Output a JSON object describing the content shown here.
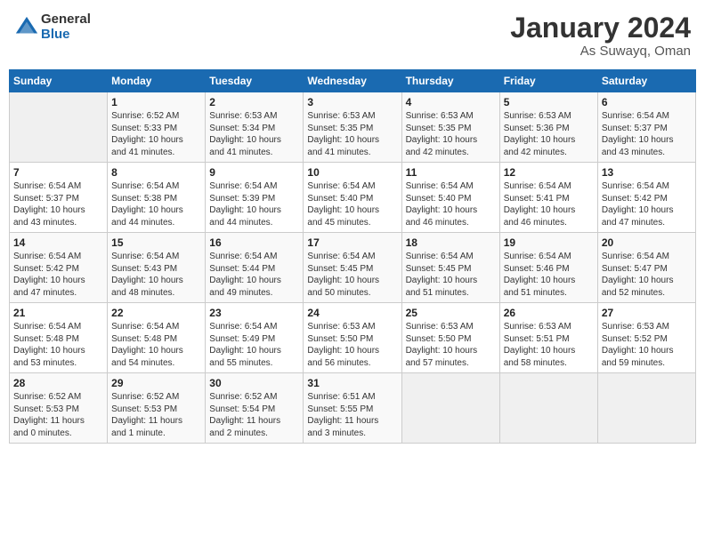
{
  "header": {
    "logo_general": "General",
    "logo_blue": "Blue",
    "month_title": "January 2024",
    "location": "As Suwayq, Oman"
  },
  "days_of_week": [
    "Sunday",
    "Monday",
    "Tuesday",
    "Wednesday",
    "Thursday",
    "Friday",
    "Saturday"
  ],
  "weeks": [
    [
      {
        "day": "",
        "info": ""
      },
      {
        "day": "1",
        "info": "Sunrise: 6:52 AM\nSunset: 5:33 PM\nDaylight: 10 hours\nand 41 minutes."
      },
      {
        "day": "2",
        "info": "Sunrise: 6:53 AM\nSunset: 5:34 PM\nDaylight: 10 hours\nand 41 minutes."
      },
      {
        "day": "3",
        "info": "Sunrise: 6:53 AM\nSunset: 5:35 PM\nDaylight: 10 hours\nand 41 minutes."
      },
      {
        "day": "4",
        "info": "Sunrise: 6:53 AM\nSunset: 5:35 PM\nDaylight: 10 hours\nand 42 minutes."
      },
      {
        "day": "5",
        "info": "Sunrise: 6:53 AM\nSunset: 5:36 PM\nDaylight: 10 hours\nand 42 minutes."
      },
      {
        "day": "6",
        "info": "Sunrise: 6:54 AM\nSunset: 5:37 PM\nDaylight: 10 hours\nand 43 minutes."
      }
    ],
    [
      {
        "day": "7",
        "info": "Sunrise: 6:54 AM\nSunset: 5:37 PM\nDaylight: 10 hours\nand 43 minutes."
      },
      {
        "day": "8",
        "info": "Sunrise: 6:54 AM\nSunset: 5:38 PM\nDaylight: 10 hours\nand 44 minutes."
      },
      {
        "day": "9",
        "info": "Sunrise: 6:54 AM\nSunset: 5:39 PM\nDaylight: 10 hours\nand 44 minutes."
      },
      {
        "day": "10",
        "info": "Sunrise: 6:54 AM\nSunset: 5:40 PM\nDaylight: 10 hours\nand 45 minutes."
      },
      {
        "day": "11",
        "info": "Sunrise: 6:54 AM\nSunset: 5:40 PM\nDaylight: 10 hours\nand 46 minutes."
      },
      {
        "day": "12",
        "info": "Sunrise: 6:54 AM\nSunset: 5:41 PM\nDaylight: 10 hours\nand 46 minutes."
      },
      {
        "day": "13",
        "info": "Sunrise: 6:54 AM\nSunset: 5:42 PM\nDaylight: 10 hours\nand 47 minutes."
      }
    ],
    [
      {
        "day": "14",
        "info": "Sunrise: 6:54 AM\nSunset: 5:42 PM\nDaylight: 10 hours\nand 47 minutes."
      },
      {
        "day": "15",
        "info": "Sunrise: 6:54 AM\nSunset: 5:43 PM\nDaylight: 10 hours\nand 48 minutes."
      },
      {
        "day": "16",
        "info": "Sunrise: 6:54 AM\nSunset: 5:44 PM\nDaylight: 10 hours\nand 49 minutes."
      },
      {
        "day": "17",
        "info": "Sunrise: 6:54 AM\nSunset: 5:45 PM\nDaylight: 10 hours\nand 50 minutes."
      },
      {
        "day": "18",
        "info": "Sunrise: 6:54 AM\nSunset: 5:45 PM\nDaylight: 10 hours\nand 51 minutes."
      },
      {
        "day": "19",
        "info": "Sunrise: 6:54 AM\nSunset: 5:46 PM\nDaylight: 10 hours\nand 51 minutes."
      },
      {
        "day": "20",
        "info": "Sunrise: 6:54 AM\nSunset: 5:47 PM\nDaylight: 10 hours\nand 52 minutes."
      }
    ],
    [
      {
        "day": "21",
        "info": "Sunrise: 6:54 AM\nSunset: 5:48 PM\nDaylight: 10 hours\nand 53 minutes."
      },
      {
        "day": "22",
        "info": "Sunrise: 6:54 AM\nSunset: 5:48 PM\nDaylight: 10 hours\nand 54 minutes."
      },
      {
        "day": "23",
        "info": "Sunrise: 6:54 AM\nSunset: 5:49 PM\nDaylight: 10 hours\nand 55 minutes."
      },
      {
        "day": "24",
        "info": "Sunrise: 6:53 AM\nSunset: 5:50 PM\nDaylight: 10 hours\nand 56 minutes."
      },
      {
        "day": "25",
        "info": "Sunrise: 6:53 AM\nSunset: 5:50 PM\nDaylight: 10 hours\nand 57 minutes."
      },
      {
        "day": "26",
        "info": "Sunrise: 6:53 AM\nSunset: 5:51 PM\nDaylight: 10 hours\nand 58 minutes."
      },
      {
        "day": "27",
        "info": "Sunrise: 6:53 AM\nSunset: 5:52 PM\nDaylight: 10 hours\nand 59 minutes."
      }
    ],
    [
      {
        "day": "28",
        "info": "Sunrise: 6:52 AM\nSunset: 5:53 PM\nDaylight: 11 hours\nand 0 minutes."
      },
      {
        "day": "29",
        "info": "Sunrise: 6:52 AM\nSunset: 5:53 PM\nDaylight: 11 hours\nand 1 minute."
      },
      {
        "day": "30",
        "info": "Sunrise: 6:52 AM\nSunset: 5:54 PM\nDaylight: 11 hours\nand 2 minutes."
      },
      {
        "day": "31",
        "info": "Sunrise: 6:51 AM\nSunset: 5:55 PM\nDaylight: 11 hours\nand 3 minutes."
      },
      {
        "day": "",
        "info": ""
      },
      {
        "day": "",
        "info": ""
      },
      {
        "day": "",
        "info": ""
      }
    ]
  ]
}
